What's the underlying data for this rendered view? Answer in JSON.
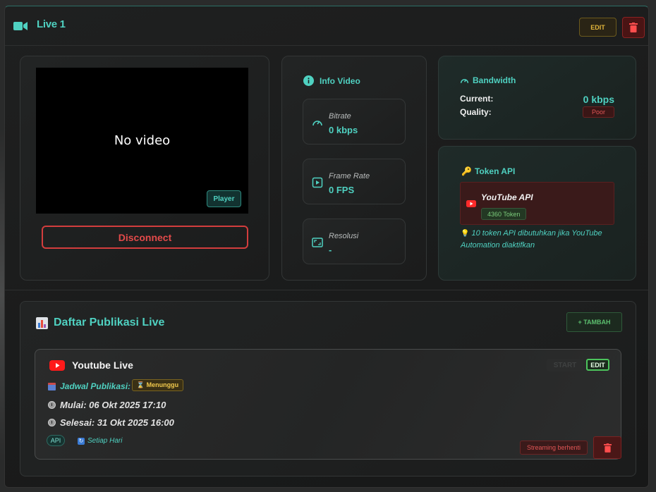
{
  "header": {
    "title": "Live 1",
    "edit_label": "EDIT"
  },
  "video": {
    "no_video_text": "No video",
    "player_label": "Player",
    "disconnect_label": "Disconnect"
  },
  "info": {
    "title": "Info Video",
    "tiles": [
      {
        "label": "Bitrate",
        "value": "0 kbps"
      },
      {
        "label": "Frame Rate",
        "value": "0 FPS"
      },
      {
        "label": "Resolusi",
        "value": "-"
      }
    ]
  },
  "bandwidth": {
    "title": "Bandwidth",
    "current_label": "Current:",
    "current_value": "0 kbps",
    "quality_label": "Quality:",
    "quality_value": "Poor"
  },
  "token": {
    "title": "Token API",
    "api_name": "YouTube API",
    "token_count": "4360 Token",
    "note": "10 token API dibutuhkan jika YouTube Automation diaktifkan"
  },
  "publications": {
    "title": "Daftar Publikasi Live",
    "add_label": "+ TAMBAH",
    "items": [
      {
        "name": "Youtube Live",
        "start_label": "START",
        "edit_label": "EDIT",
        "schedule_label": "Jadwal Publikasi:",
        "status": "⌛ Menunggu",
        "start_time": "Mulai: 06 Okt 2025 17:10",
        "end_time": "Selesai: 31 Okt 2025 16:00",
        "api_badge": "API",
        "repeat": "Setiap Hari",
        "stream_status": "Streaming berhenti"
      }
    ]
  },
  "colors": {
    "accent": "#4fd1c1",
    "danger": "#d33d3d",
    "warning": "#e3b63b",
    "success": "#5bbf6e"
  }
}
